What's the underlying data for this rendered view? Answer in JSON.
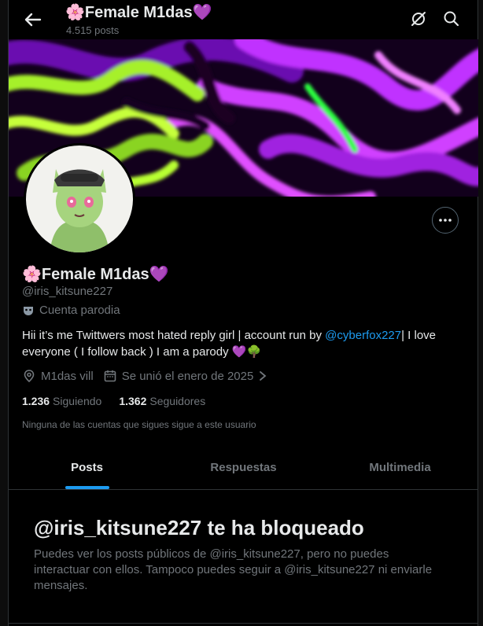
{
  "header": {
    "title": "🌸Female M1das💜",
    "post_count": "4.515 posts",
    "icons": [
      "back-arrow-icon",
      "grok-icon",
      "search-icon"
    ]
  },
  "profile": {
    "name": "🌸Female M1das💜",
    "handle": "@iris_kitsune227",
    "parody_label": "Cuenta parodia",
    "bio_part1": "Hii it’s me Twittwers most hated reply girl | account run by ",
    "bio_mention": "@cyberfox227",
    "bio_part2": "| I love everyone ( I follow back ) I am a parody 💜🌳",
    "location": "M1das vill",
    "joined": "Se unió el enero de 2025",
    "following_count": "1.236",
    "following_label": "Siguiendo",
    "followers_count": "1.362",
    "followers_label": "Seguidores",
    "mutual_note": "Ninguna de las cuentas que sigues sigue a este usuario"
  },
  "tabs": [
    {
      "label": "Posts",
      "active": true
    },
    {
      "label": "Respuestas",
      "active": false
    },
    {
      "label": "Multimedia",
      "active": false
    }
  ],
  "blocked": {
    "title": "@iris_kitsune227 te ha bloqueado",
    "message": "Puedes ver los posts públicos de @iris_kitsune227, pero no puedes interactuar con ellos. Tampoco puedes seguir a @iris_kitsune227 ni enviarle mensajes."
  },
  "colors": {
    "accent": "#1d9bf0",
    "background": "#000000",
    "muted_text": "#71767b",
    "banner_purple": "#b020ff",
    "banner_green": "#9eea2a"
  }
}
